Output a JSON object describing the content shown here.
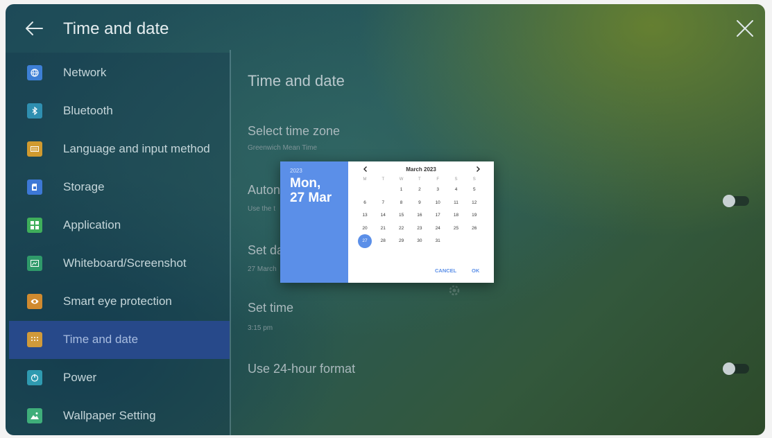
{
  "window": {
    "title": "Time and date"
  },
  "sidebar": {
    "items": [
      {
        "label": "Network",
        "icon": "globe-icon",
        "color": "#3d7fd6"
      },
      {
        "label": "Bluetooth",
        "icon": "bluetooth-icon",
        "color": "#2f8fb0"
      },
      {
        "label": "Language and input method",
        "icon": "keyboard-icon",
        "color": "#d09a2f"
      },
      {
        "label": "Storage",
        "icon": "sd-card-icon",
        "color": "#3d78d6"
      },
      {
        "label": "Application",
        "icon": "apps-grid-icon",
        "color": "#3fae5b"
      },
      {
        "label": "Whiteboard/Screenshot",
        "icon": "screenshot-icon",
        "color": "#2f9a6a"
      },
      {
        "label": "Smart eye protection",
        "icon": "eye-icon",
        "color": "#d08a2f"
      },
      {
        "label": "Time and date",
        "icon": "calendar-icon",
        "color": "#d09a3a",
        "selected": true
      },
      {
        "label": "Power",
        "icon": "power-icon",
        "color": "#2f9ab0"
      },
      {
        "label": "Wallpaper Setting",
        "icon": "image-icon",
        "color": "#3fae7a"
      }
    ]
  },
  "main": {
    "heading": "Time and date",
    "settings": [
      {
        "title": "Select time zone",
        "subtitle": "Greenwich Mean Time"
      },
      {
        "title": "Auton",
        "subtitle": "Use the t",
        "toggle": false
      },
      {
        "title": "Set da",
        "subtitle": "27 March"
      },
      {
        "title": "Set time",
        "subtitle": "3:15 pm"
      },
      {
        "title": "Use 24-hour format",
        "subtitle": "",
        "toggle": false
      }
    ]
  },
  "date_picker": {
    "year": "2023",
    "date_line1": "Mon,",
    "date_line2": "27 Mar",
    "month_title": "March 2023",
    "weekdays": [
      "M",
      "T",
      "W",
      "T",
      "F",
      "S",
      "S"
    ],
    "first_weekday_index": 2,
    "days_in_month": 31,
    "selected_day": 27,
    "cancel_label": "CANCEL",
    "ok_label": "OK",
    "accent_color": "#5b8fe8"
  }
}
